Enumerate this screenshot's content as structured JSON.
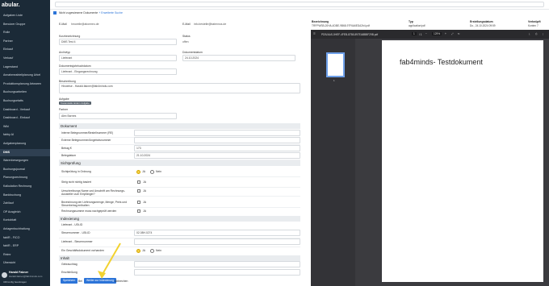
{
  "app": {
    "logo": "abular."
  },
  "sidebar": {
    "items": [
      "Aufgaben Liste",
      "Benutzer Gruppe",
      "Rolle",
      "Partner",
      "Einkauf",
      "Verkauf",
      "Lagerstand",
      "Annahmeabteilplanung Urkel",
      "Produktionsplanung Artwaren",
      "Buchungsarbeiten",
      "Buchungsetatts",
      "Dashboard - Verkauf",
      "Dashboard - Einkauf",
      "Wiki",
      "fabby AI",
      "Aufgabenplanung",
      "DMS",
      "Warenbewegungen",
      "Buchungsjournal",
      "Planungsrechnung",
      "Kalkulation Rechnung",
      "Bankbuchung",
      "Zahllauf",
      "OP Ausgleich",
      "Kontoblatt",
      "Anlagenbuchhaltung",
      "fabIR - FICO",
      "fabIR - ERP",
      "Reimr",
      "Übersicht"
    ],
    "active": "DMS",
    "user": {
      "name": "Harald Fakner",
      "sub": "Harald.fakner@fab4minds.com",
      "line": "URConfig beantragen"
    }
  },
  "topbar": {
    "search_placeholder": ""
  },
  "filterbar": {
    "label": "Nicht zugewiesene Dokumente",
    "link": "+ Erweiterte Suche"
  },
  "form": {
    "email_label": "E-Mail",
    "email_value": "hmorelle@abormeo.de",
    "email2_label": "E-Mail",
    "email2_value": "info.bestelle@batennos.de",
    "kurzbez_label": "Kurzbezeichnung",
    "kurzbez_value": "DMS Test 4",
    "status_label": "Status",
    "status_value": "offen",
    "archivtyp_label": "Archivtyp",
    "archivtyp_value": "Lieferant",
    "dokdatum_label": "Dokumentdatum",
    "dokdatum_value": "24.10.2024",
    "dokumenttyp_label": "Dokumentsjahrbuchdatum",
    "dokumenttyp_value": "Lieferant - Eingangsrechnung",
    "beschreibung_label": "Beschreibung",
    "beschreibung_value": "Hinweise - Harald.fakner@fab4minds.com",
    "aufgabe_label": "Aufgabe",
    "aufgabe_pill": "Kostenstelle ändern Aufgabe",
    "partner_label": "Partner",
    "partner_value": "Alex Barnes"
  },
  "sections": {
    "dokument": {
      "title": "Dokument",
      "rows": [
        "Interne Belegnummer/Bestellnummer (RE)",
        "Externe Belegnummer/Angebotsnummer",
        "Betrag €",
        "Belegdatum"
      ],
      "betrag": "173",
      "belegdatum": "21.10.2024"
    },
    "sichtpruefung": {
      "title": "Sichtprüfung",
      "rows": [
        "Sichtprüfung in Ordnung",
        "Steig nicht richtig basiert",
        "Umschreibungs Name und Anschrift am Rechnungs-Aussteller zum Empfänger?",
        "Bezeichnung der Lieferungsmenge, Menge, Preis und Steuerbetrag enthalten",
        "Rechnungssumme muss nachgeprüft werden"
      ],
      "ja": "JA",
      "nein": "Nein"
    },
    "indexierung": {
      "title": "Indexierung",
      "rows": [
        "Lieferant - USt-ID",
        "Steuernummer - USt-ID",
        "Lieferant - Steuernummer",
        "Ein Geschäftsdokument vorhanden"
      ],
      "datum": "02.08H.0274",
      "ja": "JA",
      "nein": "Nein"
    },
    "inhalt": {
      "title": "Inhalt",
      "rows": [
        "Gebrauchtag",
        "Erschließung"
      ]
    }
  },
  "buttons": {
    "speichern": "Speichern",
    "wieder": "Weiter zur Indexierung",
    "abbrechen": "Abbrechen",
    "bei": "Bei"
  },
  "details": {
    "bezeichnung_label": "Bezeichnung",
    "bezeichnung_value": "TRFPWSB-20HA-4DBE-9B68-97F6A6EDA2b4.pdf",
    "typ_label": "Typ",
    "typ_value": "application/pdf",
    "erstellung_label": "Erstellungsdatum",
    "erstellung_value": "Do., 24.10.2024 09:59",
    "verknuepft_label": "Verknüpft",
    "verknuepft_value": "Konten 7"
  },
  "viewer": {
    "filename": "PDS/AAS-0HEF-4FEB-8758-897EABBBF29B.pdf",
    "page": "1",
    "of": "/ 1",
    "zoom": "129%",
    "thumb_label": "1",
    "content": "fab4minds- Testdokument"
  },
  "colors": {
    "sidebar": "#1b2a37",
    "accent": "#2c74d8",
    "highlight": "#f4d04a",
    "arrow": "#f2d230"
  }
}
